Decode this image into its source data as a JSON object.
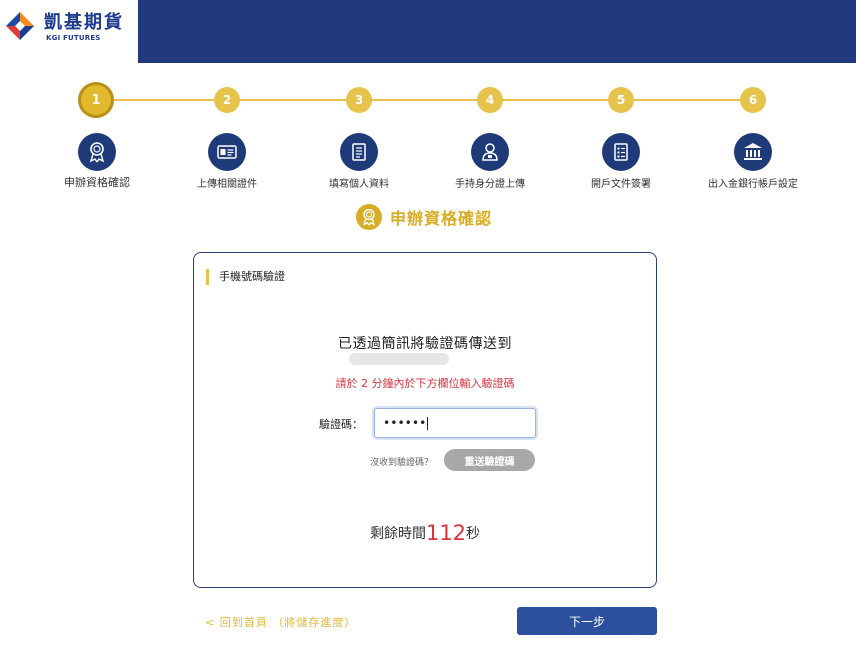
{
  "brand": {
    "name": "凱基期貨",
    "sub": "KGI FUTURES"
  },
  "steps": [
    {
      "number": "1",
      "label": "申辦資格確認",
      "icon": "award-ribbon-icon",
      "active": true
    },
    {
      "number": "2",
      "label": "上傳相關證件",
      "icon": "id-card-icon",
      "active": false
    },
    {
      "number": "3",
      "label": "填寫個人資料",
      "icon": "document-lines-icon",
      "active": false
    },
    {
      "number": "4",
      "label": "手持身分證上傳",
      "icon": "person-icon",
      "active": false
    },
    {
      "number": "5",
      "label": "開戶文件簽署",
      "icon": "checklist-document-icon",
      "active": false
    },
    {
      "number": "6",
      "label": "出入金銀行帳戶設定",
      "icon": "bank-building-icon",
      "active": false
    }
  ],
  "section": {
    "title": "申辦資格確認",
    "icon": "award-ribbon-icon"
  },
  "card": {
    "heading": "手機號碼驗證",
    "message": "已透過簡訊將驗證碼傳送到",
    "warning": "請於 2 分鐘內於下方欄位輸入驗證碼",
    "code_label": "驗證碼：",
    "code_value": "••••••",
    "no_code_text": "沒收到驗證碼？",
    "resend_label": "重送驗證碼",
    "timer_prefix": "剩餘時間",
    "timer_value": "112",
    "timer_suffix": "秒"
  },
  "footer": {
    "back_label": "< 回到首頁 （將儲存進度）",
    "next_label": "下一步"
  },
  "colors": {
    "navy": "#213a7e",
    "gold": "#e6c34a",
    "red": "#d8343c",
    "button_blue": "#2c4f9e"
  }
}
